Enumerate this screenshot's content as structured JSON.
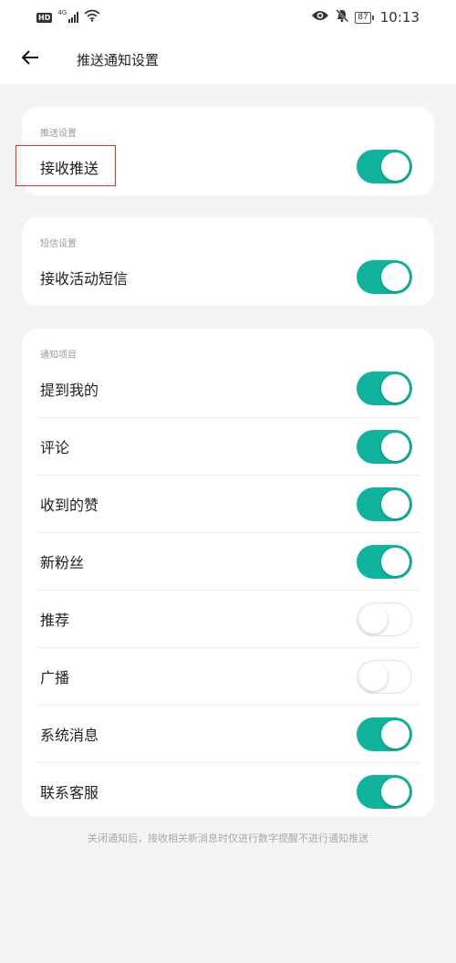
{
  "status_bar": {
    "hd": "HD",
    "network": "4G",
    "battery": "87",
    "time": "10:13"
  },
  "header": {
    "title": "推送通知设置",
    "back_icon": "arrow-left-icon"
  },
  "sections": {
    "push": {
      "title": "推送设置",
      "items": [
        {
          "label": "接收推送",
          "on": true
        }
      ]
    },
    "sms": {
      "title": "短信设置",
      "items": [
        {
          "label": "接收活动短信",
          "on": true
        }
      ]
    },
    "notify": {
      "title": "通知项目",
      "items": [
        {
          "label": "提到我的",
          "on": true
        },
        {
          "label": "评论",
          "on": true
        },
        {
          "label": "收到的赞",
          "on": true
        },
        {
          "label": "新粉丝",
          "on": true
        },
        {
          "label": "推荐",
          "on": false
        },
        {
          "label": "广播",
          "on": false
        },
        {
          "label": "系统消息",
          "on": true
        },
        {
          "label": "联系客服",
          "on": true
        }
      ]
    }
  },
  "footer_note": "关闭通知后，接收相关新消息时仅进行数字提醒不进行通知推送",
  "colors": {
    "accent": "#12b39e",
    "highlight": "#e03030",
    "background": "#f4f4f4"
  }
}
